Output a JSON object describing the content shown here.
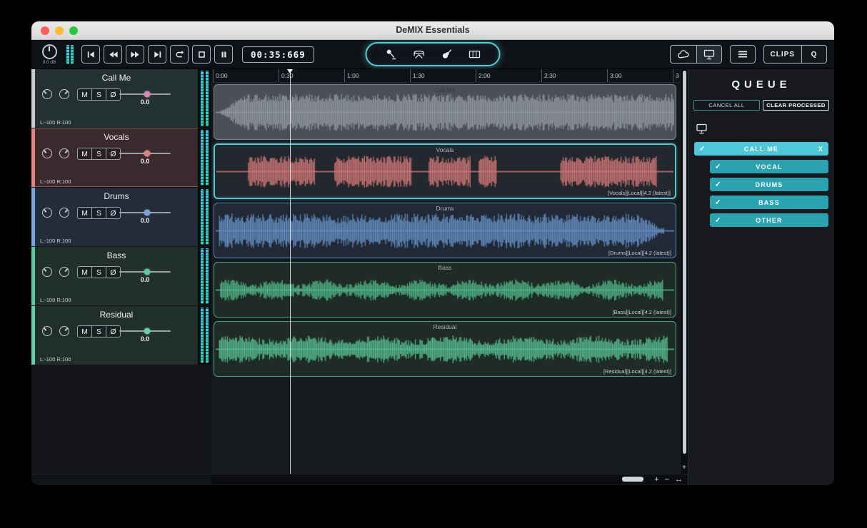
{
  "window": {
    "title": "DeMIX Essentials"
  },
  "toolbar": {
    "master_db": "0.0 dB",
    "time_display": "00:35:669",
    "clips_label": "CLIPS",
    "queue_label": "Q"
  },
  "timeline": {
    "ticks": [
      "0:00",
      "0:30",
      "1:00",
      "1:30",
      "2:00",
      "2:30",
      "3:00",
      "3"
    ]
  },
  "labels": {
    "mute": "M",
    "solo": "S",
    "phase": "Ø",
    "check_glyph": "✓"
  },
  "zoom": {
    "h_plus": "+",
    "h_minus": "−",
    "h_fit": "↔",
    "v_plus": "+"
  },
  "colors": {
    "accent": "#53c9d5",
    "meter": "#35dcc8"
  },
  "tracks": [
    {
      "name": "Call Me",
      "pan": "L:-100 R:100",
      "volume": "0.0",
      "region_label": "Call Me",
      "region_meta": "",
      "color": "#c7ccd2",
      "wave_color": "#9aa1a8",
      "label_color": "#31363c",
      "header_bg": "#243131",
      "region_bg": "#4a5056",
      "region_border": "#82888f",
      "handle_color": "#df84b8",
      "envelope": "mix",
      "selected": false
    },
    {
      "name": "Vocals",
      "pan": "L:-100 R:100",
      "volume": "0.0",
      "region_label": "Vocals",
      "region_meta": "[Vocals][Local][4.2 (latest)]",
      "color": "#e4807e",
      "wave_color": "#e8827f",
      "label_color": "#aeb5bd",
      "header_bg": "#3b2a2d",
      "region_bg": "#22282e",
      "region_border": "#53c9d5",
      "handle_color": "#e4807e",
      "envelope": "phrases",
      "selected": true
    },
    {
      "name": "Drums",
      "pan": "L:-100 R:100",
      "volume": "0.0",
      "region_label": "Drums",
      "region_meta": "[Drums][Local][4.2 (latest)]",
      "color": "#78a4d8",
      "wave_color": "#6f9cd6",
      "label_color": "#aeb5bd",
      "header_bg": "#232c39",
      "region_bg": "#202935",
      "region_border": "#5d87ba",
      "handle_color": "#78a4d8",
      "envelope": "drums",
      "selected": false
    },
    {
      "name": "Bass",
      "pan": "L:-100 R:100",
      "volume": "0.0",
      "region_label": "Bass",
      "region_meta": "[Bass][Local][4.2 (latest)]",
      "color": "#5bc99b",
      "wave_color": "#57c795",
      "label_color": "#aeb5bd",
      "header_bg": "#213029",
      "region_bg": "#1f2b26",
      "region_border": "#4aa37f",
      "handle_color": "#5bc99b",
      "envelope": "bass",
      "selected": false
    },
    {
      "name": "Residual",
      "pan": "L:-100 R:100",
      "volume": "0.0",
      "region_label": "Residual",
      "region_meta": "[Residual][Local][4.2 (latest)]",
      "color": "#61d1a4",
      "wave_color": "#5fd0a0",
      "label_color": "#aeb5bd",
      "header_bg": "#203029",
      "region_bg": "#1e2b26",
      "region_border": "#49a37e",
      "handle_color": "#61d1a4",
      "envelope": "residual",
      "selected": false
    }
  ],
  "queue": {
    "title": "QUEUE",
    "cancel_all": "CANCEL ALL",
    "clear_processed": "CLEAR PROCESSED",
    "items": [
      {
        "label": "CALL ME",
        "selected": true,
        "close": "X"
      },
      {
        "label": "VOCAL",
        "selected": false
      },
      {
        "label": "DRUMS",
        "selected": false
      },
      {
        "label": "BASS",
        "selected": false
      },
      {
        "label": "OTHER",
        "selected": false
      }
    ]
  }
}
